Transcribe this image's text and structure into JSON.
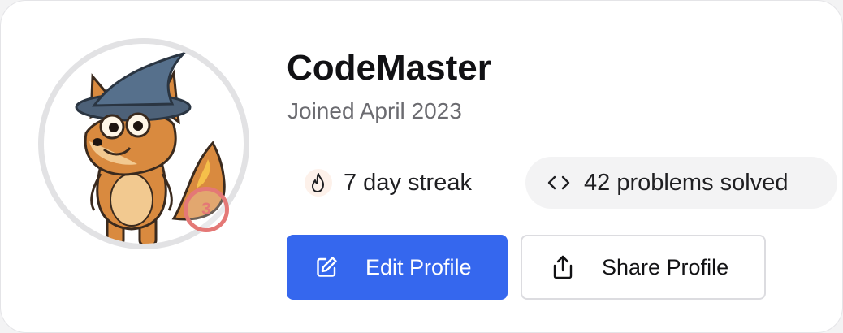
{
  "profile": {
    "username": "CodeMaster",
    "joined": "Joined April 2023",
    "level": "3",
    "avatar": "fox-wizard-avatar"
  },
  "stats": {
    "streak": {
      "icon": "flame-icon",
      "label": "7 day streak"
    },
    "solved": {
      "icon": "code-brackets-icon",
      "label": "42 problems solved"
    }
  },
  "actions": {
    "edit": {
      "icon": "edit-icon",
      "label": "Edit Profile"
    },
    "share": {
      "icon": "share-icon",
      "label": "Share Profile"
    }
  },
  "colors": {
    "primary": "#3567ee",
    "badge": "#e47876",
    "muted_text": "#6b6b70"
  }
}
